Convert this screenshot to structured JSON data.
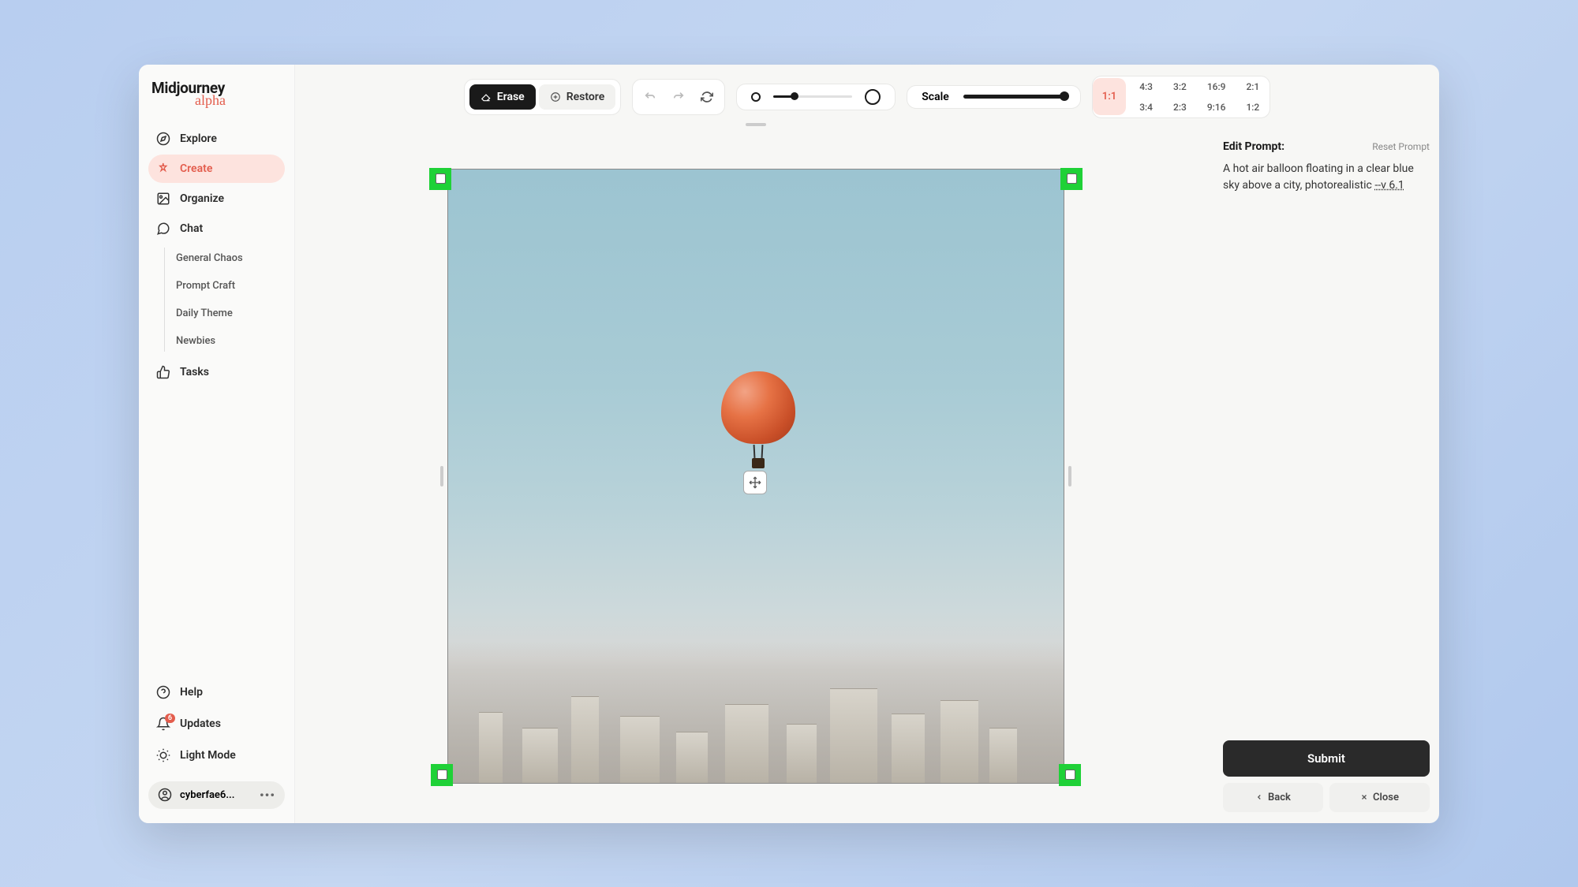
{
  "logo": {
    "main": "Midjourney",
    "sub": "alpha"
  },
  "sidebar": {
    "items": [
      {
        "label": "Explore"
      },
      {
        "label": "Create"
      },
      {
        "label": "Organize"
      },
      {
        "label": "Chat"
      }
    ],
    "chat_rooms": [
      {
        "label": "General Chaos"
      },
      {
        "label": "Prompt Craft"
      },
      {
        "label": "Daily Theme"
      },
      {
        "label": "Newbies"
      }
    ],
    "tasks_label": "Tasks"
  },
  "sidebar_bottom": {
    "help": "Help",
    "updates": "Updates",
    "updates_badge": "6",
    "light_mode": "Light Mode",
    "username": "cyberfae6..."
  },
  "toolbar": {
    "erase": "Erase",
    "restore": "Restore",
    "scale_label": "Scale"
  },
  "ratios": {
    "active": "1:1",
    "grid": [
      "4:3",
      "3:2",
      "16:9",
      "2:1",
      "3:4",
      "2:3",
      "9:16",
      "1:2"
    ]
  },
  "prompt": {
    "title": "Edit Prompt:",
    "reset": "Reset Prompt",
    "text_main": "A hot air balloon floating in a clear blue sky above a city, photorealistic ",
    "text_param": "--v 6.1"
  },
  "buttons": {
    "submit": "Submit",
    "back": "Back",
    "close": "Close"
  }
}
